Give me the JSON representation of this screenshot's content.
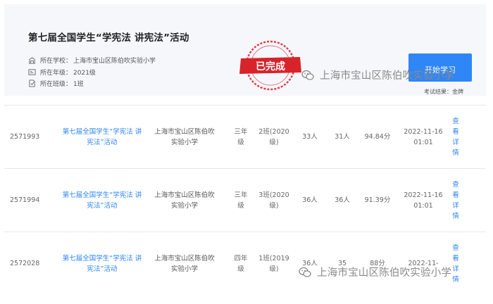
{
  "card": {
    "title": "第七届全国学生“学宪法 讲宪法”活动",
    "school_label": "所在学校：",
    "school_value": "上海市宝山区陈伯吹实验小学",
    "grade_label": "所在年级：",
    "grade_value": "2021级",
    "class_label": "所在班级：",
    "class_value": "1班",
    "stamp_text": "已完成",
    "start_button": "开始学习",
    "result_label": "考试结果：",
    "result_value": "金牌"
  },
  "watermark": {
    "text": "上海市宝山区陈伯吹实验小学"
  },
  "rows": [
    {
      "id": "2571993",
      "activity": "第七届全国学生“学宪法 讲宪法”活动",
      "school": "上海市宝山区陈伯吹实验小学",
      "grade": "三年级",
      "class": "2班(2020级)",
      "count_a": "33人",
      "count_b": "31人",
      "score": "94.84分",
      "time": "2022-11-16 01:01",
      "detail": "查看详情"
    },
    {
      "id": "2571994",
      "activity": "第七届全国学生“学宪法 讲宪法”活动",
      "school": "上海市宝山区陈伯吹实验小学",
      "grade": "三年级",
      "class": "3班(2020级)",
      "count_a": "36人",
      "count_b": "36人",
      "score": "91.39分",
      "time": "2022-11-16 01:01",
      "detail": "查看详情"
    },
    {
      "id": "2572028",
      "activity": "第七届全国学生“学宪法 讲宪法”活动",
      "school": "上海市宝山区陈伯吹实验小学",
      "grade": "四年级",
      "class": "1班(2019级)",
      "count_a": "36人",
      "count_b": "35",
      "score": "88分",
      "time": "2022-11-",
      "detail": "查看详情"
    }
  ],
  "colors": {
    "accent": "#2f86f6",
    "stamp": "#d8232a"
  }
}
